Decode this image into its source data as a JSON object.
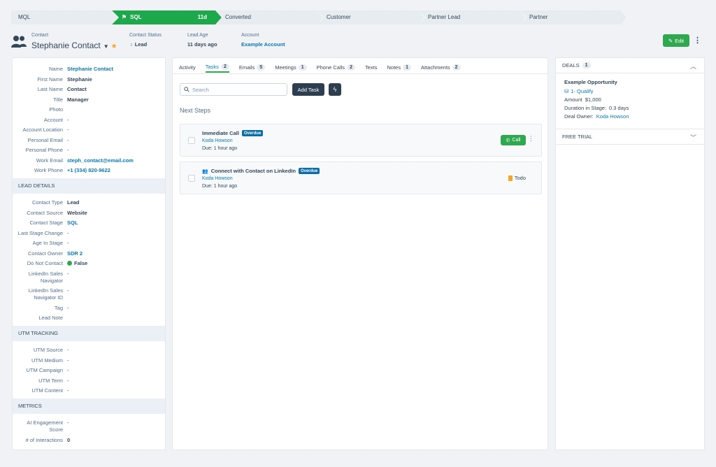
{
  "pipeline": {
    "stages": [
      {
        "label": "MQL",
        "days": ""
      },
      {
        "label": "SQL",
        "days": "11d"
      },
      {
        "label": "Converted",
        "days": ""
      },
      {
        "label": "Customer",
        "days": ""
      },
      {
        "label": "Partner Lead",
        "days": ""
      },
      {
        "label": "Partner",
        "days": ""
      }
    ],
    "active_color": "#1ea84c"
  },
  "header": {
    "type_label": "Contact",
    "name": "Stephanie Contact",
    "status_label": "Contact Status",
    "status_value": "Lead",
    "age_label": "Lead Age",
    "age_value": "11 days ago",
    "account_label": "Account",
    "account_value": "Example Account",
    "edit_label": "Edit"
  },
  "details": {
    "name_label": "Name",
    "name": "Stephanie Contact",
    "first_label": "First Name",
    "first": "Stephanie",
    "last_label": "Last Name",
    "last": "Contact",
    "title_label": "Title",
    "title": "Manager",
    "photo_label": "Photo",
    "account_label": "Account",
    "account": "-",
    "location_label": "Account Location",
    "location": "-",
    "pemail_label": "Personal Email",
    "pemail": "-",
    "pphone_label": "Personal Phone",
    "pphone": "-",
    "wemail_label": "Work Email",
    "wemail": "steph_contact@email.com",
    "wphone_label": "Work Phone",
    "wphone": "+1 (334) 820-9622"
  },
  "lead_details": {
    "heading": "LEAD DETAILS",
    "ctype_label": "Contact Type",
    "ctype": "Lead",
    "csource_label": "Contact Source",
    "csource": "Website",
    "cstage_label": "Contact Stage",
    "cstage": "SQL",
    "lchange_label": "Last Stage Change",
    "lchange": "-",
    "age_label": "Age In Stage",
    "age": "-",
    "owner_label": "Contact Owner",
    "owner": "SDR 2",
    "dnc_label": "Do Not Contact",
    "dnc": "False",
    "lin_label_1": "LinkedIn Sales",
    "lin_label_2": "Navigator",
    "lin": "-",
    "linid_label_1": "LinkedIn Sales",
    "linid_label_2": "Navigator ID",
    "linid": "-",
    "tag_label": "Tag",
    "tag": "-",
    "note_label": "Lead Note"
  },
  "utm": {
    "heading": "UTM TRACKING",
    "source_label": "UTM Source",
    "source": "-",
    "medium_label": "UTM Medium",
    "medium": "-",
    "campaign_label": "UTM Campaign",
    "campaign": "-",
    "term_label": "UTM Term",
    "term": "-",
    "content_label": "UTM Content",
    "content": "-"
  },
  "metrics": {
    "heading": "METRICS",
    "ai_label_1": "AI Engagement",
    "ai_label_2": "Score",
    "ai": "-",
    "inter_label": "# of Interactions",
    "inter": "0"
  },
  "tabs": [
    {
      "label": "Activity",
      "count": ""
    },
    {
      "label": "Tasks",
      "count": "2"
    },
    {
      "label": "Emails",
      "count": "5"
    },
    {
      "label": "Meetings",
      "count": "1"
    },
    {
      "label": "Phone Calls",
      "count": "2"
    },
    {
      "label": "Texts",
      "count": ""
    },
    {
      "label": "Notes",
      "count": "1"
    },
    {
      "label": "Attachments",
      "count": "2"
    }
  ],
  "tasks_panel": {
    "search_placeholder": "Search",
    "add_task": "Add Task",
    "next_steps": "Next Steps",
    "tasks": [
      {
        "title": "Immediate Call",
        "badge": "Overdue",
        "owner": "Koda Howson",
        "due": "Due: 1 hour ago",
        "action": "Call"
      },
      {
        "title": "Connect with Contact on LinkedIn",
        "badge": "Overdue",
        "owner": "Koda Howson",
        "due": "Due: 1 hour ago",
        "action": "Todo"
      }
    ]
  },
  "deals": {
    "heading": "DEALS",
    "count": "1",
    "name": "Example Opportunity",
    "stage": "1- Qualify",
    "amount_label": "Amount",
    "amount": "$1,000",
    "duration_label": "Duration in Stage:",
    "duration": "0.3 days",
    "owner_label": "Deal Owner:",
    "owner": "Koda Howson",
    "trial_heading": "FREE TRIAL"
  }
}
